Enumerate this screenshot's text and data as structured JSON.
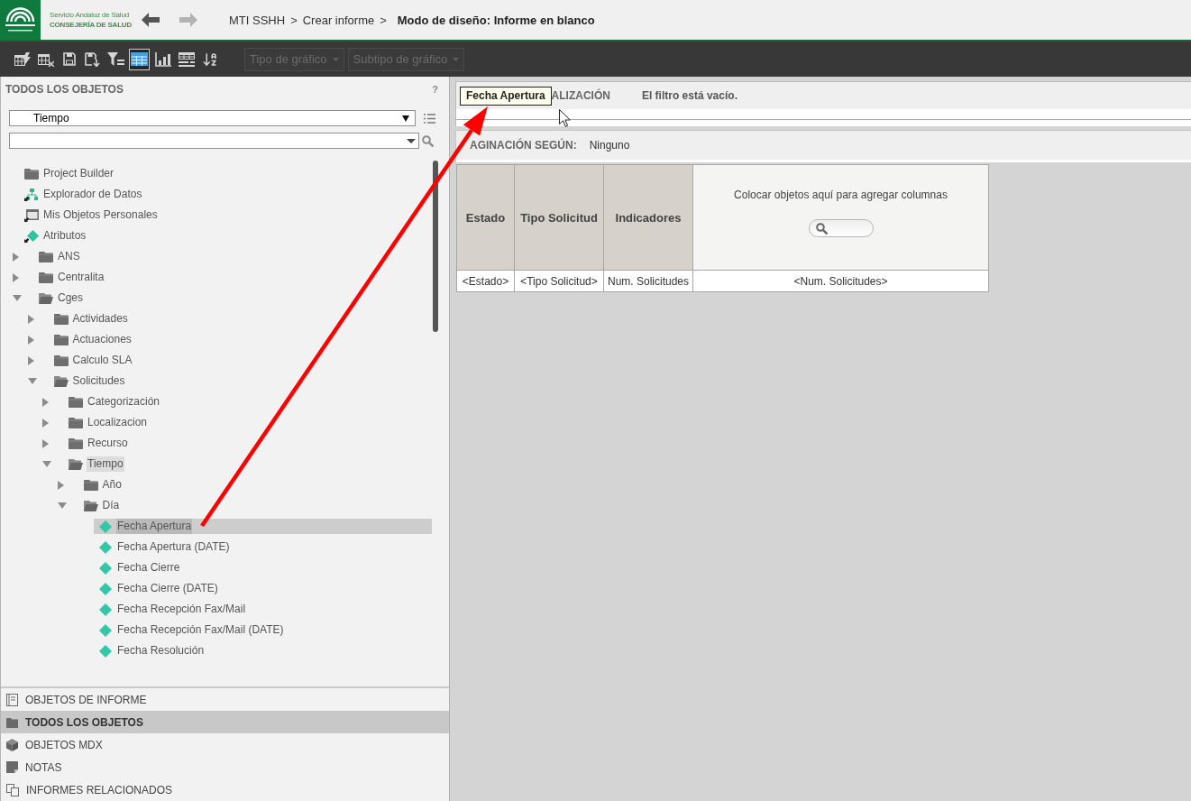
{
  "header": {
    "logo": {
      "line_1": "Servicio Andaluz de Salud",
      "line_2": "CONSEJERÍA DE SALUD"
    },
    "navigation": [
      {
        "kind": "back",
        "disabled": false
      },
      {
        "kind": "forward",
        "disabled": true
      }
    ],
    "breadcrumb": [
      {
        "label": "MTI SSHH",
        "separator": ">",
        "current": false
      },
      {
        "label": "Crear informe",
        "separator": ">",
        "current": false
      },
      {
        "label": "Modo de diseño: Informe en blanco",
        "current": true
      }
    ]
  },
  "toolbar": {
    "buttons": [
      {
        "kind": "run_report",
        "selected": false
      },
      {
        "kind": "clear_grid",
        "selected": false
      },
      {
        "kind": "save",
        "selected": false
      },
      {
        "kind": "save_as",
        "selected": false
      },
      {
        "kind": "filter",
        "selected": false
      },
      {
        "kind": "grid_view",
        "selected": true
      },
      {
        "kind": "graph_view",
        "selected": false
      },
      {
        "kind": "grid_graph_view",
        "selected": false
      },
      {
        "kind": "sort",
        "selected": false
      }
    ],
    "dropdowns": [
      {
        "label": "Tipo de gráfico",
        "disabled": true
      },
      {
        "label": "Subtipo de gráfico",
        "disabled": true
      }
    ]
  },
  "sidebar": {
    "title": "TODOS LOS OBJETOS",
    "help_label": "?",
    "folder_select": {
      "value": "Tiempo"
    },
    "tree": [
      {
        "label": "Project Builder",
        "kind": "folder",
        "selected": false,
        "highlighted": false
      },
      {
        "label": "Explorador de Datos",
        "kind": "data_explorer",
        "selected": false,
        "highlighted": false
      },
      {
        "label": "Mis Objetos Personales",
        "kind": "personal_objects",
        "selected": false,
        "highlighted": false
      },
      {
        "label": "Atributos",
        "kind": "attribute_shortcut",
        "selected": false,
        "highlighted": false,
        "children": [
          {
            "label": "ANS",
            "kind": "folder",
            "expanded": false,
            "selected": false,
            "highlighted": false
          },
          {
            "label": "Centralita",
            "kind": "folder",
            "expanded": false,
            "selected": false,
            "highlighted": false
          },
          {
            "label": "Cges",
            "kind": "folder",
            "expanded": true,
            "selected": false,
            "highlighted": false,
            "children": [
              {
                "label": "Actividades",
                "kind": "folder",
                "expanded": false,
                "selected": false,
                "highlighted": false
              },
              {
                "label": "Actuaciones",
                "kind": "folder",
                "expanded": false,
                "selected": false,
                "highlighted": false
              },
              {
                "label": "Calculo SLA",
                "kind": "folder",
                "expanded": false,
                "selected": false,
                "highlighted": false
              },
              {
                "label": "Solicitudes",
                "kind": "folder",
                "expanded": true,
                "selected": false,
                "highlighted": false,
                "children": [
                  {
                    "label": "Categorización",
                    "kind": "folder",
                    "expanded": false,
                    "selected": false,
                    "highlighted": false
                  },
                  {
                    "label": "Localizacion",
                    "kind": "folder",
                    "expanded": false,
                    "selected": false,
                    "highlighted": false
                  },
                  {
                    "label": "Recurso",
                    "kind": "folder",
                    "expanded": false,
                    "selected": false,
                    "highlighted": false
                  },
                  {
                    "label": "Tiempo",
                    "kind": "folder",
                    "expanded": true,
                    "selected": false,
                    "highlighted": true,
                    "children": [
                      {
                        "label": "Año",
                        "kind": "folder",
                        "expanded": false,
                        "selected": false,
                        "highlighted": false
                      },
                      {
                        "label": "Día",
                        "kind": "folder",
                        "expanded": true,
                        "selected": false,
                        "highlighted": false,
                        "children": [
                          {
                            "label": "Fecha Apertura",
                            "kind": "attribute",
                            "selected": true,
                            "highlighted": false
                          },
                          {
                            "label": "Fecha Apertura (DATE)",
                            "kind": "attribute",
                            "selected": false,
                            "highlighted": false
                          },
                          {
                            "label": "Fecha Cierre",
                            "kind": "attribute",
                            "selected": false,
                            "highlighted": false
                          },
                          {
                            "label": "Fecha Cierre (DATE)",
                            "kind": "attribute",
                            "selected": false,
                            "highlighted": false
                          },
                          {
                            "label": "Fecha Recepción Fax/Mail",
                            "kind": "attribute",
                            "selected": false,
                            "highlighted": false
                          },
                          {
                            "label": "Fecha Recepción Fax/Mail (DATE)",
                            "kind": "attribute",
                            "selected": false,
                            "highlighted": false
                          },
                          {
                            "label": "Fecha Resolución",
                            "kind": "attribute",
                            "selected": false,
                            "highlighted": false
                          }
                        ]
                      }
                    ]
                  }
                ]
              }
            ]
          }
        ]
      }
    ],
    "sections": [
      {
        "kind": "report_objects",
        "label": "OBJETOS DE INFORME",
        "selected": false
      },
      {
        "kind": "all_objects",
        "label": "TODOS LOS OBJETOS",
        "selected": true
      },
      {
        "kind": "mdx_objects",
        "label": "OBJETOS MDX",
        "selected": false
      },
      {
        "kind": "notes",
        "label": "NOTAS",
        "selected": false
      },
      {
        "kind": "related_reports",
        "label": "INFORMES RELACIONADOS",
        "selected": false
      }
    ]
  },
  "editor": {
    "filter": {
      "drag_tooltip": "Fecha Apertura",
      "label": "ALIZACIÓN",
      "text": "El filtro está vacío."
    },
    "paging": {
      "label": "AGINACIÓN SEGÚN:",
      "value": "Ninguno"
    },
    "grid": {
      "columns": [
        "Estado",
        "Tipo Solicitud",
        "Indicadores"
      ],
      "drop_zone": {
        "text": "Colocar objetos aquí para agregar columnas"
      },
      "rows": [
        [
          "<Estado>",
          "<Tipo Solicitud>",
          "Num. Solicitudes",
          "<Num. Solicitudes>"
        ]
      ]
    }
  }
}
